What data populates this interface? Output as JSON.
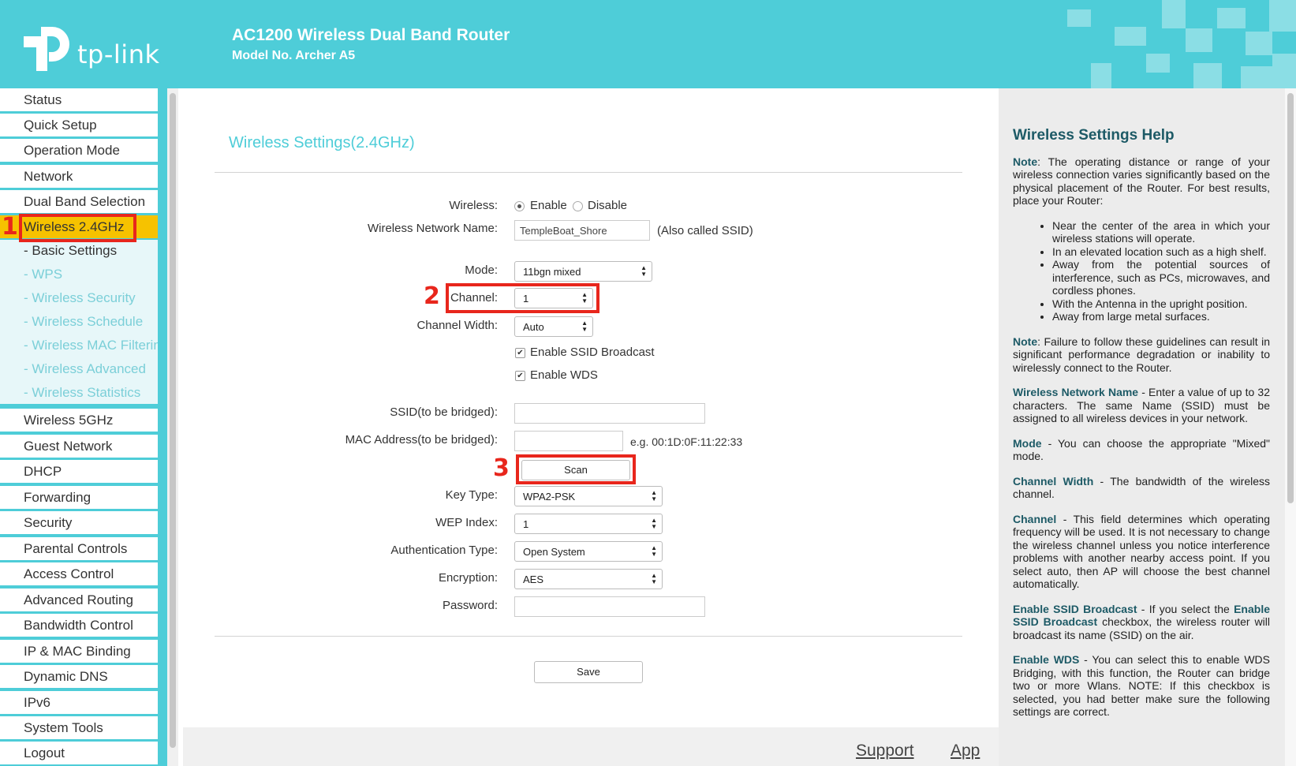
{
  "header": {
    "logo_text": "tp-link",
    "title": "AC1200 Wireless Dual Band Router",
    "model": "Model No. Archer A5"
  },
  "sidebar": {
    "items_top": [
      "Status",
      "Quick Setup",
      "Operation Mode",
      "Network",
      "Dual Band Selection"
    ],
    "active": "Wireless 2.4GHz",
    "sub_items": [
      "- Basic Settings",
      "- WPS",
      "- Wireless Security",
      "- Wireless Schedule",
      "- Wireless MAC Filtering",
      "- Wireless Advanced",
      "- Wireless Statistics"
    ],
    "items_bottom": [
      "Wireless 5GHz",
      "Guest Network",
      "DHCP",
      "Forwarding",
      "Security",
      "Parental Controls",
      "Access Control",
      "Advanced Routing",
      "Bandwidth Control",
      "IP & MAC Binding",
      "Dynamic DNS",
      "IPv6",
      "System Tools",
      "Logout"
    ]
  },
  "main": {
    "title": "Wireless Settings(2.4GHz)",
    "wireless_label": "Wireless:",
    "enable_label": "Enable",
    "disable_label": "Disable",
    "wireless_state": "Enable",
    "ssid_label": "Wireless Network Name:",
    "ssid_value": "TempleBoat_Shore",
    "ssid_note": "(Also called SSID)",
    "mode_label": "Mode:",
    "mode_value": "11bgn mixed",
    "channel_label": "Channel:",
    "channel_value": "1",
    "width_label": "Channel Width:",
    "width_value": "Auto",
    "ssid_broadcast_label": "Enable SSID Broadcast",
    "ssid_broadcast_checked": true,
    "wds_label": "Enable WDS",
    "wds_checked": true,
    "bridged_ssid_label": "SSID(to be bridged):",
    "bridged_ssid_value": "",
    "bridged_mac_label": "MAC Address(to be bridged):",
    "bridged_mac_value": "",
    "mac_example": "e.g. 00:1D:0F:11:22:33",
    "scan_label": "Scan",
    "key_type_label": "Key Type:",
    "key_type_value": "WPA2-PSK",
    "wep_index_label": "WEP Index:",
    "wep_index_value": "1",
    "auth_type_label": "Authentication Type:",
    "auth_type_value": "Open System",
    "encryption_label": "Encryption:",
    "encryption_value": "AES",
    "password_label": "Password:",
    "password_value": "",
    "save_label": "Save"
  },
  "annotations": {
    "step1": "1",
    "step2": "2",
    "step3": "3",
    "color": "#e8261c"
  },
  "footer": {
    "support": "Support",
    "app": "App"
  },
  "help": {
    "title": "Wireless Settings Help",
    "note1_kw": "Note",
    "note1_text": ": The operating distance or range of your wireless connection varies significantly based on the physical placement of the Router. For best results, place your Router:",
    "bullets": [
      "Near the center of the area in which your wireless stations will operate.",
      "In an elevated location such as a high shelf.",
      "Away from the potential sources of interference, such as PCs, microwaves, and cordless phones.",
      "With the Antenna in the upright position.",
      "Away from large metal surfaces."
    ],
    "note2_kw": "Note",
    "note2_text": ": Failure to follow these guidelines can result in significant performance degradation or inability to wirelessly connect to the Router.",
    "wnn_kw": "Wireless Network Name",
    "wnn_text": " - Enter a value of up to 32 characters. The same Name (SSID) must be assigned to all wireless devices in your network.",
    "mode_kw": "Mode",
    "mode_text": " - You can choose the appropriate \"Mixed\" mode.",
    "cw_kw": "Channel Width",
    "cw_text": " - The bandwidth of the wireless channel.",
    "ch_kw": "Channel",
    "ch_text": " - This field determines which operating frequency will be used. It is not necessary to change the wireless channel unless you notice interference problems with another nearby access point. If you select auto, then AP will choose the best channel automatically.",
    "esb_kw": "Enable SSID Broadcast",
    "esb_text1": " - If you select the ",
    "esb_kw2": "Enable SSID Broadcast",
    "esb_text2": " checkbox, the wireless router will broadcast its name (SSID) on the air.",
    "wds_kw": "Enable WDS",
    "wds_text": " - You can select this to enable WDS Bridging, with this function, the Router can bridge two or more Wlans. NOTE: If this checkbox is selected, you had better make sure the following settings are correct."
  }
}
